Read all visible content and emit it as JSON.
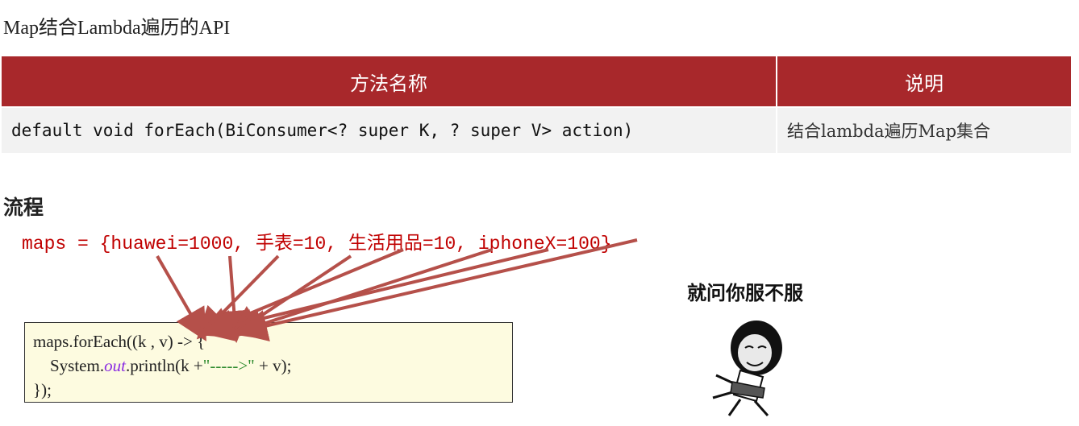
{
  "title": "Map结合Lambda遍历的API",
  "table": {
    "headers": {
      "method": "方法名称",
      "desc": "说明"
    },
    "rows": [
      {
        "method": "default void forEach(BiConsumer<? super K, ? super V> action)",
        "desc": "结合lambda遍历Map集合"
      }
    ]
  },
  "flow": {
    "heading": "流程",
    "maps_line": "maps = {huawei=1000, 手表=10, 生活用品=10, iphoneX=100}",
    "code": {
      "line1": "maps.forEach((k , v) -> {",
      "line2_pre": "    System.",
      "line2_out": "out",
      "line2_mid": ".println(k +",
      "line2_str": "\"----->\"",
      "line2_post": " + v);",
      "line3": "});"
    }
  },
  "meme": {
    "caption": "就问你服不服",
    "icon": "meme-face-icon"
  },
  "colors": {
    "header_bg": "#a8282b",
    "row_bg": "#f2f2f2",
    "maps_text": "#c00000",
    "arrow": "#b5504a",
    "code_bg": "#fdfbe0"
  }
}
